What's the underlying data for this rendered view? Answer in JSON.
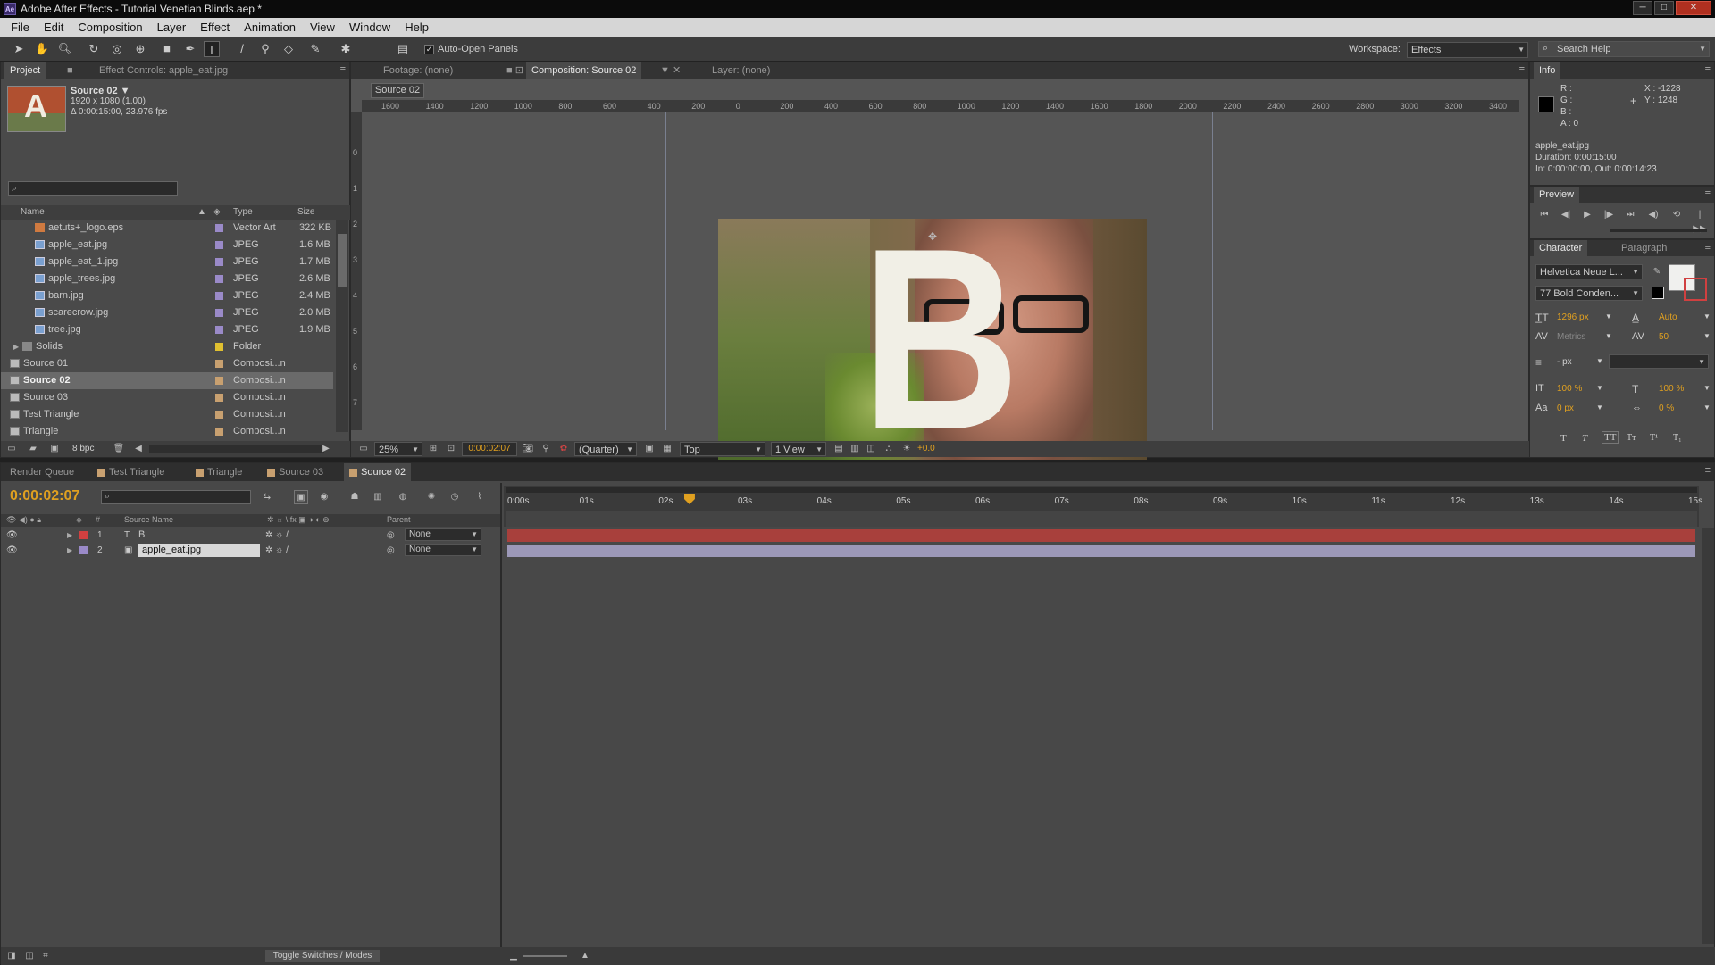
{
  "window": {
    "title": "Adobe After Effects - Tutorial Venetian Blinds.aep *",
    "app_icon": "Ae"
  },
  "menu": [
    "File",
    "Edit",
    "Composition",
    "Layer",
    "Effect",
    "Animation",
    "View",
    "Window",
    "Help"
  ],
  "toolbar": {
    "auto_open_panels": "Auto-Open Panels",
    "workspace_label": "Workspace:",
    "workspace_value": "Effects",
    "search_placeholder": "Search Help"
  },
  "project": {
    "tab": "Project",
    "effect_controls_tab": "Effect Controls: apple_eat.jpg",
    "comp_name": "Source 02 ▼",
    "comp_size": "1920 x 1080 (1.00)",
    "comp_duration": "Δ 0:00:15:00, 23.976 fps",
    "thumb_letter": "A",
    "columns": [
      "Name",
      "Type",
      "Size"
    ],
    "items": [
      {
        "name": "aetuts+_logo.eps",
        "type": "Vector Art",
        "size": "322 KB",
        "kind": "eps",
        "color": "#9a8ac8"
      },
      {
        "name": "apple_eat.jpg",
        "type": "JPEG",
        "size": "1.6 MB",
        "kind": "img",
        "color": "#9a8ac8"
      },
      {
        "name": "apple_eat_1.jpg",
        "type": "JPEG",
        "size": "1.7 MB",
        "kind": "img",
        "color": "#9a8ac8"
      },
      {
        "name": "apple_trees.jpg",
        "type": "JPEG",
        "size": "2.6 MB",
        "kind": "img",
        "color": "#9a8ac8"
      },
      {
        "name": "barn.jpg",
        "type": "JPEG",
        "size": "2.4 MB",
        "kind": "img",
        "color": "#9a8ac8"
      },
      {
        "name": "scarecrow.jpg",
        "type": "JPEG",
        "size": "2.0 MB",
        "kind": "img",
        "color": "#9a8ac8"
      },
      {
        "name": "tree.jpg",
        "type": "JPEG",
        "size": "1.9 MB",
        "kind": "img",
        "color": "#9a8ac8"
      },
      {
        "name": "Solids",
        "type": "Folder",
        "size": "",
        "kind": "folder",
        "color": "#e0c030"
      },
      {
        "name": "Source 01",
        "type": "Composi...n",
        "size": "",
        "kind": "comp",
        "color": "#c8a070"
      },
      {
        "name": "Source 02",
        "type": "Composi...n",
        "size": "",
        "kind": "comp",
        "color": "#c8a070",
        "selected": true
      },
      {
        "name": "Source 03",
        "type": "Composi...n",
        "size": "",
        "kind": "comp",
        "color": "#c8a070"
      },
      {
        "name": "Test Triangle",
        "type": "Composi...n",
        "size": "",
        "kind": "comp",
        "color": "#c8a070"
      },
      {
        "name": "Triangle",
        "type": "Composi...n",
        "size": "",
        "kind": "comp",
        "color": "#c8a070"
      }
    ],
    "bpc": "8 bpc"
  },
  "viewer": {
    "tabs": [
      "Footage: (none)",
      "Composition: Source 02",
      "Layer: (none)"
    ],
    "comp_button": "Source 02",
    "ruler_labels": [
      "1600",
      "1400",
      "1200",
      "1000",
      "800",
      "600",
      "400",
      "200",
      "0",
      "200",
      "400",
      "600",
      "800",
      "1000",
      "1200",
      "1400",
      "1600",
      "1800",
      "2000",
      "2200",
      "2400",
      "2600",
      "2800",
      "3000",
      "3200",
      "3400"
    ],
    "ruler_v_labels": [
      "0",
      "1",
      "2",
      "3",
      "4",
      "5",
      "6",
      "7",
      "8"
    ],
    "letter": "B",
    "zoom": "25%",
    "time": "0:00:02:07",
    "resolution": "(Quarter)",
    "view": "Top",
    "views": "1 View",
    "exposure": "+0.0"
  },
  "info": {
    "tab": "Info",
    "r": "R :",
    "g": "G :",
    "b": "B :",
    "a": "A : 0",
    "x": "X : -1228",
    "y": "Y : 1248",
    "file": "apple_eat.jpg",
    "duration": "Duration: 0:00:15:00",
    "inout": "In: 0:00:00:00, Out: 0:00:14:23"
  },
  "preview": {
    "tab": "Preview"
  },
  "character": {
    "tab": "Character",
    "tab2": "Paragraph",
    "font": "Helvetica Neue L...",
    "style": "77 Bold Conden...",
    "size": "1296 px",
    "leading": "Auto",
    "kerning": "Metrics",
    "tracking": "50",
    "stroke": "- px",
    "vscale": "100 %",
    "hscale": "100 %",
    "baseline": "0 px",
    "tsume": "0 %"
  },
  "timeline": {
    "tabs": [
      "Render Queue",
      "Test Triangle",
      "Triangle",
      "Source 03",
      "Source 02"
    ],
    "timecode": "0:00:02:07",
    "col_source": "Source Name",
    "col_parent": "Parent",
    "col_num": "#",
    "layers": [
      {
        "num": "1",
        "name": "B",
        "color": "#d04040",
        "kind": "text",
        "parent": "None",
        "bar": "#a8403c"
      },
      {
        "num": "2",
        "name": "apple_eat.jpg",
        "color": "#9a8ac8",
        "kind": "img",
        "parent": "None",
        "bar": "#9c98b8",
        "selected": true
      }
    ],
    "time_labels": [
      "0:00s",
      "01s",
      "02s",
      "03s",
      "04s",
      "05s",
      "06s",
      "07s",
      "08s",
      "09s",
      "10s",
      "11s",
      "12s",
      "13s",
      "14s",
      "15s"
    ],
    "current_time_sec": 2.3,
    "toggle": "Toggle Switches / Modes"
  }
}
